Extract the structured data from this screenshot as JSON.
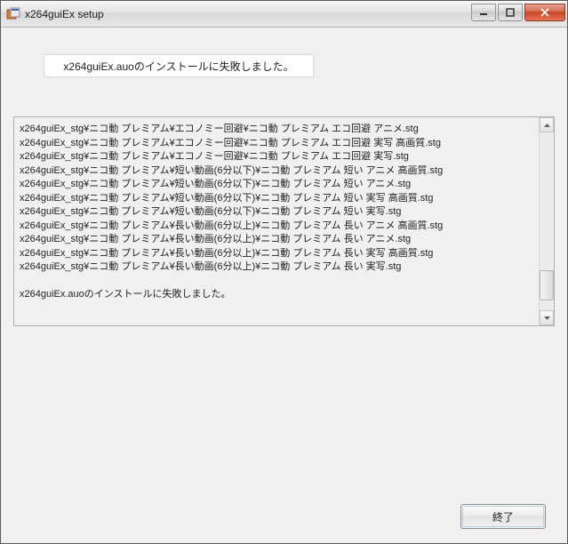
{
  "window": {
    "title": "x264guiEx setup"
  },
  "banner": {
    "message": "x264guiEx.auoのインストールに失敗しました。"
  },
  "log": {
    "lines": [
      "x264guiEx_stg¥ニコ動 プレミアム¥エコノミー回避¥ニコ動 プレミアム エコ回避 アニメ.stg",
      "x264guiEx_stg¥ニコ動 プレミアム¥エコノミー回避¥ニコ動 プレミアム エコ回避 実写 高画質.stg",
      "x264guiEx_stg¥ニコ動 プレミアム¥エコノミー回避¥ニコ動 プレミアム エコ回避 実写.stg",
      "x264guiEx_stg¥ニコ動 プレミアム¥短い動画(6分以下)¥ニコ動 プレミアム 短い アニメ 高画質.stg",
      "x264guiEx_stg¥ニコ動 プレミアム¥短い動画(6分以下)¥ニコ動 プレミアム 短い アニメ.stg",
      "x264guiEx_stg¥ニコ動 プレミアム¥短い動画(6分以下)¥ニコ動 プレミアム 短い 実写 高画質.stg",
      "x264guiEx_stg¥ニコ動 プレミアム¥短い動画(6分以下)¥ニコ動 プレミアム 短い 実写.stg",
      "x264guiEx_stg¥ニコ動 プレミアム¥長い動画(6分以上)¥ニコ動 プレミアム 長い アニメ 高画質.stg",
      "x264guiEx_stg¥ニコ動 プレミアム¥長い動画(6分以上)¥ニコ動 プレミアム 長い アニメ.stg",
      "x264guiEx_stg¥ニコ動 プレミアム¥長い動画(6分以上)¥ニコ動 プレミアム 長い 実写 高画質.stg",
      "x264guiEx_stg¥ニコ動 プレミアム¥長い動画(6分以上)¥ニコ動 プレミアム 長い 実写.stg"
    ],
    "final_message": "x264guiEx.auoのインストールに失敗しました。"
  },
  "buttons": {
    "exit": "終了"
  }
}
